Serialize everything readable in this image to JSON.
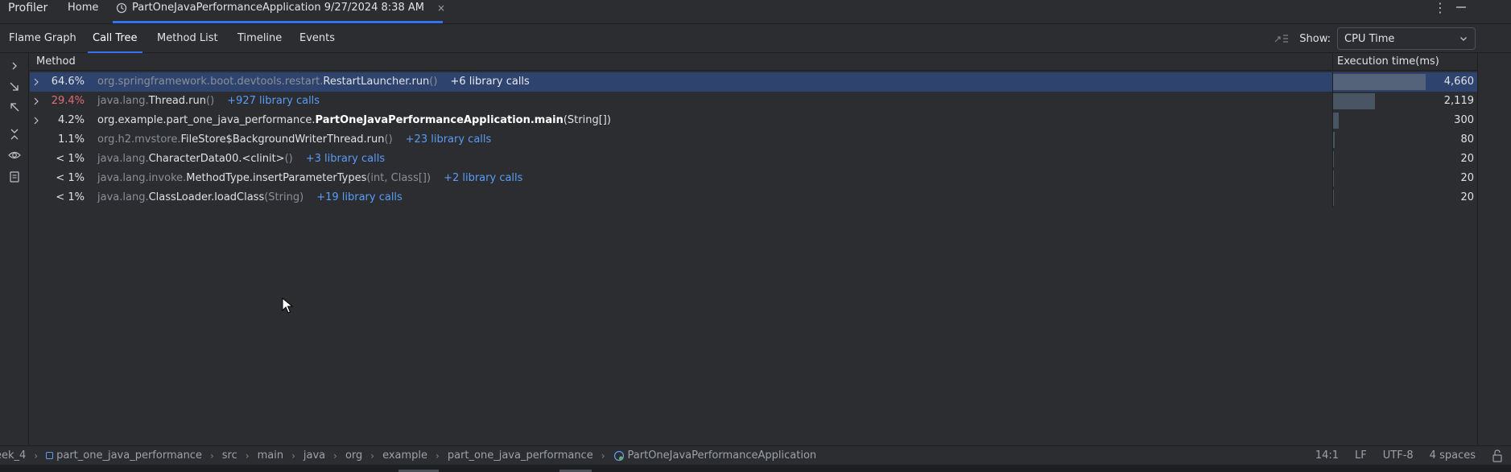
{
  "topbar": {
    "title": "Profiler",
    "home_label": "Home",
    "session_label": "PartOneJavaPerformanceApplication 9/27/2024 8:38 AM",
    "close_glyph": "×",
    "more_glyph": "⋮"
  },
  "tabs": [
    {
      "label": "Flame Graph",
      "active": false
    },
    {
      "label": "Call Tree",
      "active": true
    },
    {
      "label": "Method List",
      "active": false
    },
    {
      "label": "Timeline",
      "active": false
    },
    {
      "label": "Events",
      "active": false
    }
  ],
  "show": {
    "label": "Show:",
    "selected": "CPU Time"
  },
  "table": {
    "col_method": "Method",
    "col_time": "Execution time(ms)",
    "max_time": 4660,
    "rows": [
      {
        "pct": "64.6%",
        "pkg": "org.springframework.boot.devtools.restart.",
        "name": "RestartLauncher.run",
        "args": "()",
        "libcalls": "+6 library calls",
        "time": "4,660",
        "value": 4660,
        "expandable": true,
        "selected": true,
        "hot": false,
        "user": false
      },
      {
        "pct": "29.4%",
        "pkg": "java.lang.",
        "name": "Thread.run",
        "args": "()",
        "libcalls": "+927 library calls",
        "time": "2,119",
        "value": 2119,
        "expandable": true,
        "selected": false,
        "hot": true,
        "user": false
      },
      {
        "pct": "4.2%",
        "pkg": "org.example.part_one_java_performance.",
        "name": "PartOneJavaPerformanceApplication.main",
        "args": "(String[])",
        "libcalls": "",
        "time": "300",
        "value": 300,
        "expandable": true,
        "selected": false,
        "hot": false,
        "user": true
      },
      {
        "pct": "1.1%",
        "pkg": "org.h2.mvstore.",
        "name": "FileStore$BackgroundWriterThread.run",
        "args": "()",
        "libcalls": "+23 library calls",
        "time": "80",
        "value": 80,
        "expandable": false,
        "selected": false,
        "hot": false,
        "user": false
      },
      {
        "pct": "< 1%",
        "pkg": "java.lang.",
        "name": "CharacterData00.<clinit>",
        "args": "()",
        "libcalls": "+3 library calls",
        "time": "20",
        "value": 20,
        "expandable": false,
        "selected": false,
        "hot": false,
        "user": false
      },
      {
        "pct": "< 1%",
        "pkg": "java.lang.invoke.",
        "name": "MethodType.insertParameterTypes",
        "args": "(int, Class[])",
        "libcalls": "+2 library calls",
        "time": "20",
        "value": 20,
        "expandable": false,
        "selected": false,
        "hot": false,
        "user": false
      },
      {
        "pct": "< 1%",
        "pkg": "java.lang.",
        "name": "ClassLoader.loadClass",
        "args": "(String)",
        "libcalls": "+19 library calls",
        "time": "20",
        "value": 20,
        "expandable": false,
        "selected": false,
        "hot": false,
        "user": false
      }
    ]
  },
  "toolstrip": [
    "expand-icon",
    "navigate-into-icon",
    "navigate-back-icon",
    "collapse-all-icon",
    "eye-icon",
    "document-icon"
  ],
  "statusbar": {
    "crumbs": [
      {
        "label": "eek_4",
        "icon": ""
      },
      {
        "label": "part_one_java_performance",
        "icon": "module-icon"
      },
      {
        "label": "src",
        "icon": ""
      },
      {
        "label": "main",
        "icon": ""
      },
      {
        "label": "java",
        "icon": ""
      },
      {
        "label": "org",
        "icon": ""
      },
      {
        "label": "example",
        "icon": ""
      },
      {
        "label": "part_one_java_performance",
        "icon": ""
      },
      {
        "label": "PartOneJavaPerformanceApplication",
        "icon": "class-icon"
      }
    ],
    "position": "14:1",
    "line_ending": "LF",
    "encoding": "UTF-8",
    "indent": "4 spaces"
  },
  "colors": {
    "background": "#2b2d30",
    "accent": "#3574f0",
    "selected_row": "#2e436e",
    "library_link": "#5a9cf8",
    "hot_percent": "#e06c75"
  }
}
